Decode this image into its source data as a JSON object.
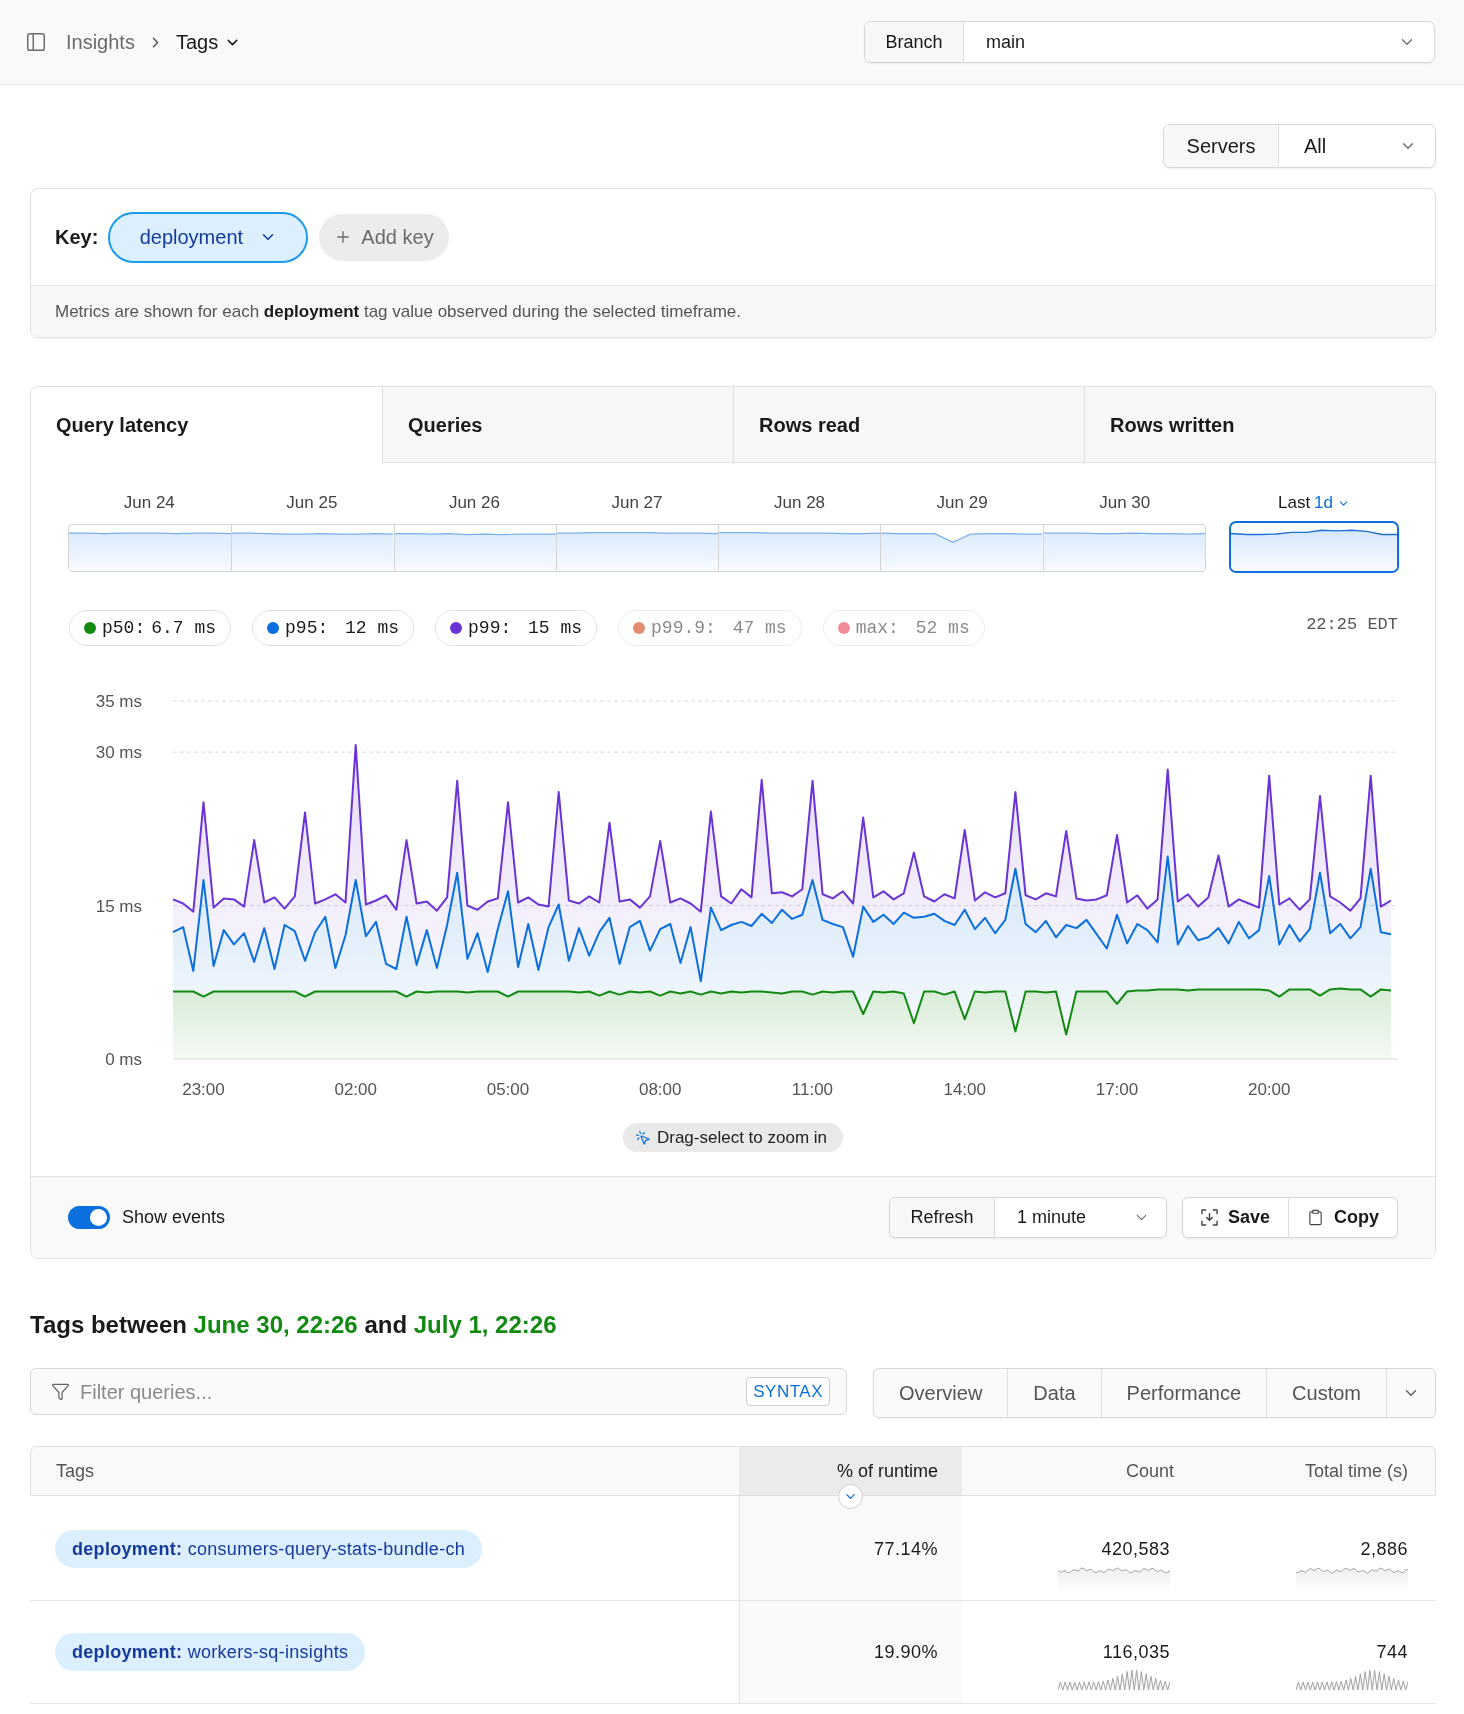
{
  "header": {
    "breadcrumbs": [
      {
        "label": "Insights",
        "current": false
      },
      {
        "label": "Tags",
        "current": true
      }
    ],
    "branch": {
      "label": "Branch",
      "value": "main"
    }
  },
  "servers": {
    "label": "Servers",
    "value": "All"
  },
  "key_card": {
    "label": "Key:",
    "key": "deployment",
    "add_label": "Add key",
    "note": "Metrics are shown for each **deployment** tag value observed during the selected timeframe."
  },
  "metric_tabs": [
    {
      "label": "Query latency",
      "selected": true
    },
    {
      "label": "Queries",
      "selected": false
    },
    {
      "label": "Rows read",
      "selected": false
    },
    {
      "label": "Rows written",
      "selected": false
    }
  ],
  "timeline": {
    "days": [
      {
        "label": "Jun 24",
        "selected": false
      },
      {
        "label": "Jun 25",
        "selected": false
      },
      {
        "label": "Jun 26",
        "selected": false
      },
      {
        "label": "Jun 27",
        "selected": false
      },
      {
        "label": "Jun 28",
        "selected": false
      },
      {
        "label": "Jun 29",
        "selected": false
      },
      {
        "label": "Jun 30",
        "selected": false
      }
    ],
    "range": {
      "label": "Last",
      "value": "1d",
      "selected": true
    }
  },
  "legend": [
    {
      "value": "6.7 ms",
      "selected": true
    },
    {
      "value": "12 ms",
      "selected": true
    },
    {
      "value": "15 ms",
      "selected": true
    },
    {
      "label": "p99.9:",
      "value": "47 ms",
      "color": "#e28c70",
      "selected": false
    },
    {
      "label": "max:",
      "value": "52 ms",
      "color": "#f28c98",
      "selected": false
    }
  ],
  "chart": {
    "current_time": "22:25 EDT",
    "drag_hint": "Drag-select to zoom in",
    "chart_data": {
      "type": "area",
      "stacked": false,
      "ylim": [
        0,
        35
      ],
      "yticks": [
        {
          "value": 0,
          "label": "0 ms"
        },
        {
          "value": 15,
          "label": "15 ms"
        },
        {
          "value": 30,
          "label": "30 ms"
        },
        {
          "value": 35,
          "label": "35 ms"
        }
      ],
      "categories": [
        null,
        null,
        null,
        "23:00",
        null,
        null,
        null,
        null,
        null,
        null,
        null,
        null,
        null,
        null,
        null,
        null,
        null,
        null,
        "02:00",
        null,
        null,
        null,
        null,
        null,
        null,
        null,
        null,
        null,
        null,
        null,
        null,
        null,
        null,
        "05:00",
        null,
        null,
        null,
        null,
        null,
        null,
        null,
        null,
        null,
        null,
        null,
        null,
        null,
        null,
        "08:00",
        null,
        null,
        null,
        null,
        null,
        null,
        null,
        null,
        null,
        null,
        null,
        null,
        null,
        null,
        "11:00",
        null,
        null,
        null,
        null,
        null,
        null,
        null,
        null,
        null,
        null,
        null,
        null,
        null,
        null,
        "14:00",
        null,
        null,
        null,
        null,
        null,
        null,
        null,
        null,
        null,
        null,
        null,
        null,
        null,
        null,
        "17:00",
        null,
        null,
        null,
        null,
        null,
        null,
        null,
        null,
        null,
        null,
        null,
        null,
        null,
        null,
        "20:00",
        null,
        null,
        null,
        null,
        null,
        null,
        null,
        null,
        null,
        null,
        null,
        null
      ],
      "series": [
        {
          "name": "p50:",
          "color": "#128a12",
          "values": [
            6.6,
            6.6,
            6.6,
            6.1,
            6.6,
            6.6,
            6.6,
            6.6,
            6.6,
            6.6,
            6.6,
            6.6,
            6.6,
            6.1,
            6.6,
            6.6,
            6.6,
            6.6,
            6.6,
            6.6,
            6.6,
            6.6,
            6.6,
            6.1,
            6.6,
            6.5,
            6.6,
            6.6,
            6.6,
            6.5,
            6.6,
            6.6,
            6.6,
            6.1,
            6.6,
            6.6,
            6.6,
            6.6,
            6.6,
            6.6,
            6.5,
            6.6,
            6.2,
            6.6,
            6.3,
            6.6,
            6.5,
            6.6,
            6.2,
            6.6,
            6.4,
            6.6,
            6.3,
            6.6,
            6.4,
            6.6,
            6.5,
            6.6,
            6.6,
            6.5,
            6.4,
            6.6,
            6.6,
            6.3,
            6.6,
            6.5,
            6.6,
            6.6,
            4.4,
            6.6,
            6.5,
            6.6,
            6.4,
            3.5,
            6.6,
            6.6,
            6.3,
            6.6,
            3.9,
            6.6,
            6.5,
            6.6,
            6.6,
            2.7,
            6.6,
            6.6,
            6.5,
            6.6,
            2.4,
            6.6,
            6.6,
            6.6,
            6.6,
            5.4,
            6.6,
            6.7,
            6.7,
            6.8,
            6.8,
            6.8,
            6.7,
            6.8,
            6.8,
            6.8,
            6.8,
            6.8,
            6.8,
            6.8,
            6.7,
            6.1,
            6.8,
            6.8,
            6.8,
            6.2,
            6.8,
            6.9,
            6.8,
            6.8,
            6.1,
            6.8,
            6.7
          ]
        },
        {
          "name": "p95:",
          "color": "#0b6fde",
          "values": [
            12.4,
            12.9,
            8.6,
            17.5,
            9.1,
            12.6,
            11.2,
            12.3,
            9.5,
            12.8,
            8.8,
            13.1,
            12.5,
            9.6,
            12.4,
            13.9,
            8.9,
            12.1,
            17.5,
            12,
            13.4,
            9.3,
            8.8,
            13.9,
            9.2,
            12.6,
            8.9,
            13.1,
            18.2,
            9.8,
            12.3,
            8.5,
            12.7,
            16.4,
            9,
            13.2,
            8.7,
            12.9,
            15.1,
            9.6,
            12.8,
            10.1,
            12.4,
            13.8,
            9.3,
            12.9,
            13.5,
            10.6,
            12.7,
            13.2,
            9.4,
            12.9,
            7.6,
            14.8,
            12.6,
            13.1,
            13.4,
            13,
            14.2,
            13.3,
            14.6,
            13.7,
            14.1,
            17.5,
            13.6,
            13.2,
            12.9,
            10,
            14.9,
            13.4,
            14.1,
            13.2,
            14.3,
            13.8,
            13.9,
            14.2,
            13.5,
            13.1,
            14.6,
            12.7,
            13.8,
            12.3,
            13.6,
            18.6,
            13.2,
            12.4,
            13.5,
            11.9,
            13.1,
            12.8,
            13.6,
            12.2,
            10.8,
            14.1,
            11.3,
            13.2,
            12.6,
            11.4,
            19.8,
            11.2,
            13,
            11.6,
            11.9,
            12.8,
            11.3,
            13.4,
            11.8,
            12.6,
            17.9,
            11.2,
            13.1,
            11.5,
            12.7,
            18.2,
            12.3,
            13.2,
            11.8,
            12.9,
            18.6,
            12.4,
            12.2
          ]
        },
        {
          "name": "p99:",
          "color": "#6a33d6",
          "values": [
            15.6,
            15.2,
            14.4,
            25.1,
            14.8,
            15.7,
            15.6,
            14.9,
            21.4,
            15.3,
            15.8,
            14.7,
            15.9,
            24.1,
            15.2,
            15.6,
            16.1,
            15.3,
            30.7,
            15.1,
            15.5,
            16,
            14.6,
            21.4,
            15.2,
            15.4,
            14.5,
            15.8,
            27.2,
            15,
            14.6,
            15.4,
            15.7,
            25.1,
            15.3,
            15.8,
            15.1,
            14.9,
            26.1,
            15.5,
            15.2,
            15.9,
            15.3,
            23.1,
            15.4,
            15.6,
            14.8,
            15.9,
            21.3,
            15.3,
            15.7,
            15.2,
            14.4,
            24.2,
            15.9,
            15.2,
            16.6,
            15.8,
            27.3,
            16.2,
            16.3,
            15.9,
            16.6,
            27.2,
            16.1,
            15.7,
            16.4,
            15.2,
            23.6,
            15.8,
            16.4,
            15.6,
            16.2,
            20.2,
            15.9,
            15.4,
            16.1,
            15.7,
            22.4,
            15.5,
            16.3,
            15.8,
            16.2,
            26.1,
            16,
            15.6,
            16.2,
            15.9,
            22.3,
            15.7,
            15.5,
            15.6,
            16,
            21.9,
            15.3,
            16,
            14.7,
            15.6,
            28.3,
            15.4,
            16.1,
            14.9,
            15.8,
            19.9,
            14.9,
            15.6,
            15.2,
            14.8,
            27.7,
            15.1,
            15.7,
            14.6,
            15.6,
            25.7,
            15.9,
            15.3,
            14.5,
            15.7,
            27.7,
            14.9,
            15.5
          ]
        }
      ]
    }
  },
  "chart_footer": {
    "show_events": {
      "label": "Show events",
      "on": true
    },
    "refresh": {
      "label": "Refresh",
      "value": "1 minute"
    },
    "actions": [
      {
        "kind": "save",
        "label": "Save"
      },
      {
        "kind": "copy",
        "label": "Copy"
      }
    ]
  },
  "tags_heading": [
    {
      "kind": "text",
      "text": "Tags between"
    },
    {
      "kind": "date",
      "text": "June 30, 22:26"
    },
    {
      "kind": "text",
      "text": "and"
    },
    {
      "kind": "date",
      "text": "July 1, 22:26"
    }
  ],
  "filter": {
    "placeholder": "Filter queries...",
    "syntax": "SYNTAX"
  },
  "views": [
    {
      "label": "Overview",
      "selected": false
    },
    {
      "label": "Data",
      "selected": false
    },
    {
      "label": "Performance",
      "selected": false
    },
    {
      "label": "Custom",
      "selected": false
    }
  ],
  "table": {
    "columns": [
      {
        "label": "Tags",
        "sorted": false
      },
      {
        "label": "% of runtime",
        "sorted": true
      },
      {
        "label": "Count",
        "sorted": false
      },
      {
        "label": "Total time (s)",
        "sorted": false
      }
    ],
    "rows": [
      {
        "tag_key": "deployment:",
        "tag_value": "consumers-query-stats-bundle-ch",
        "runtime": "77.14%",
        "count": "420,583",
        "total_time": "2,886"
      },
      {
        "tag_key": "deployment:",
        "tag_value": "workers-sq-insights",
        "runtime": "19.90%",
        "count": "116,035",
        "total_time": "744"
      }
    ]
  }
}
